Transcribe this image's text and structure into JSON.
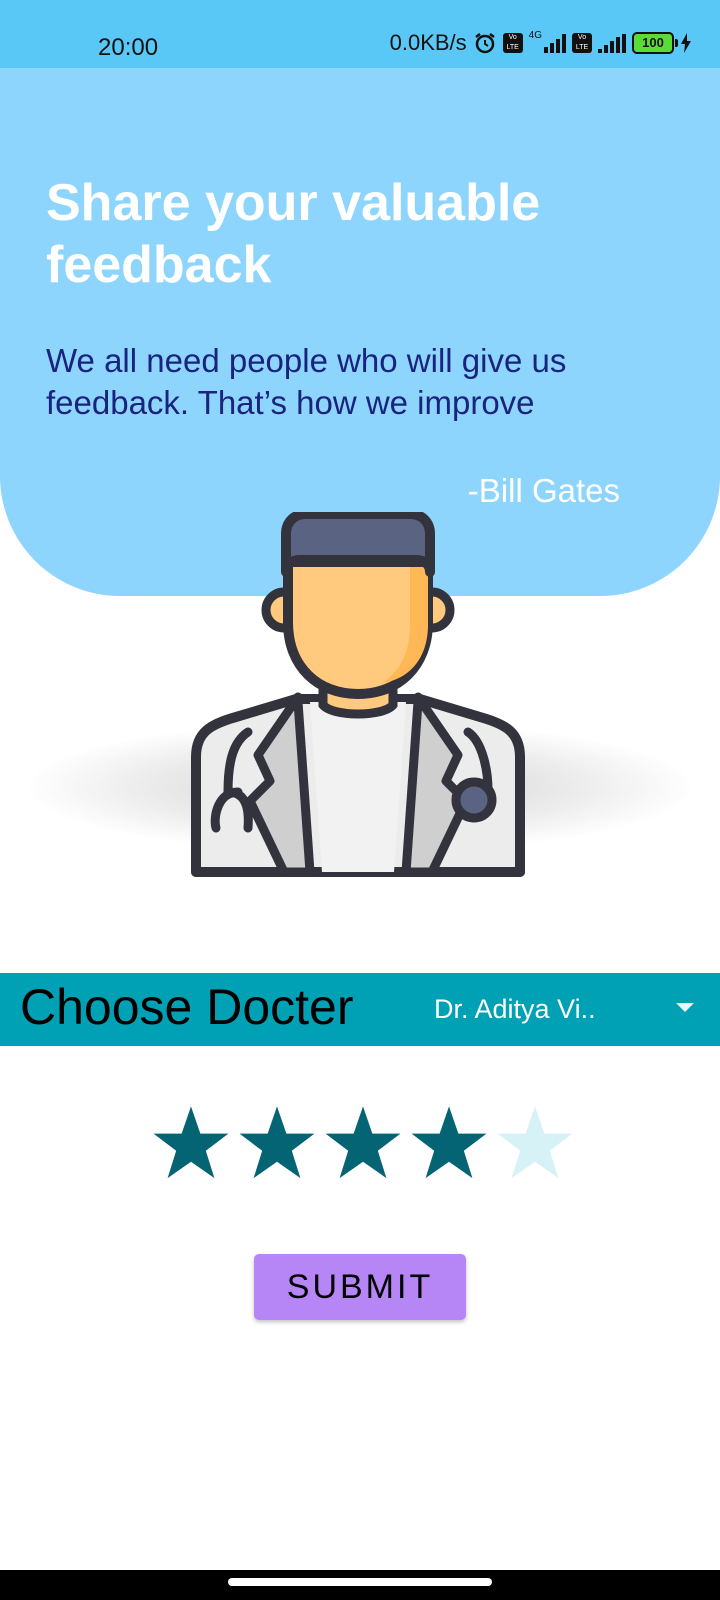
{
  "status_bar": {
    "time": "20:00",
    "network_speed": "0.0KB/s",
    "volte_label": "Vo LTE",
    "network_type": "4G",
    "battery": "100",
    "icons": [
      "alarm-icon",
      "volte-icon",
      "signal-icon",
      "battery-icon",
      "charging-icon"
    ]
  },
  "hero": {
    "title": "Share your valuable feedback",
    "quote": "We all need people who will give us feedback. That’s how we improve",
    "author": "-Bill Gates"
  },
  "choose_doctor": {
    "label": "Choose Docter",
    "selected": "Dr. Aditya Vi.."
  },
  "rating": {
    "value": 4,
    "max": 5,
    "filled_color": "#046473",
    "empty_color": "#d7f2f6"
  },
  "submit": {
    "label": "SUBMIT"
  },
  "colors": {
    "status_bar": "#5ac8f7",
    "hero": "#8dd5fd",
    "choose_bar": "#00a0b5",
    "button": "#b686f6"
  }
}
